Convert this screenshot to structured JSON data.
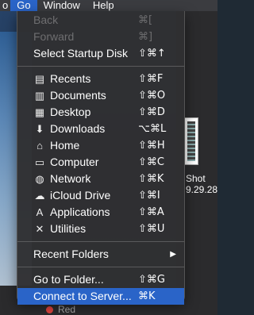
{
  "menubar": {
    "items": [
      "Go",
      "Window",
      "Help"
    ],
    "partial_left": "o"
  },
  "menu": {
    "group1": [
      {
        "label": "Back",
        "shortcut": "⌘[",
        "disabled": true
      },
      {
        "label": "Forward",
        "shortcut": "⌘]",
        "disabled": true
      },
      {
        "label": "Select Startup Disk",
        "shortcut": "⇧⌘↑",
        "disabled": false
      }
    ],
    "group2": [
      {
        "label": "Recents",
        "shortcut": "⇧⌘F",
        "icon": "recents-icon",
        "glyph": "▤"
      },
      {
        "label": "Documents",
        "shortcut": "⇧⌘O",
        "icon": "documents-icon",
        "glyph": "▥"
      },
      {
        "label": "Desktop",
        "shortcut": "⇧⌘D",
        "icon": "desktop-icon",
        "glyph": "▦"
      },
      {
        "label": "Downloads",
        "shortcut": "⌥⌘L",
        "icon": "downloads-icon",
        "glyph": "⬇"
      },
      {
        "label": "Home",
        "shortcut": "⇧⌘H",
        "icon": "home-icon",
        "glyph": "⌂"
      },
      {
        "label": "Computer",
        "shortcut": "⇧⌘C",
        "icon": "computer-icon",
        "glyph": "▭"
      },
      {
        "label": "Network",
        "shortcut": "⇧⌘K",
        "icon": "network-icon",
        "glyph": "◍"
      },
      {
        "label": "iCloud Drive",
        "shortcut": "⇧⌘I",
        "icon": "icloud-icon",
        "glyph": "☁"
      },
      {
        "label": "Applications",
        "shortcut": "⇧⌘A",
        "icon": "applications-icon",
        "glyph": "A"
      },
      {
        "label": "Utilities",
        "shortcut": "⇧⌘U",
        "icon": "utilities-icon",
        "glyph": "✕"
      }
    ],
    "recent_folders": {
      "label": "Recent Folders",
      "arrow": "▶"
    },
    "group4": [
      {
        "label": "Go to Folder...",
        "shortcut": "⇧⌘G",
        "highlight": false
      },
      {
        "label": "Connect to Server...",
        "shortcut": "⌘K",
        "highlight": true
      }
    ]
  },
  "desktop": {
    "file_label_1": "Shot",
    "file_label_2": "9.29.28",
    "tag_label": "Red",
    "tag_color": "#e0443e"
  },
  "colors": {
    "highlight": "#2a64c8",
    "menu_bg": "#303032",
    "disabled_text": "#6e6e70"
  }
}
